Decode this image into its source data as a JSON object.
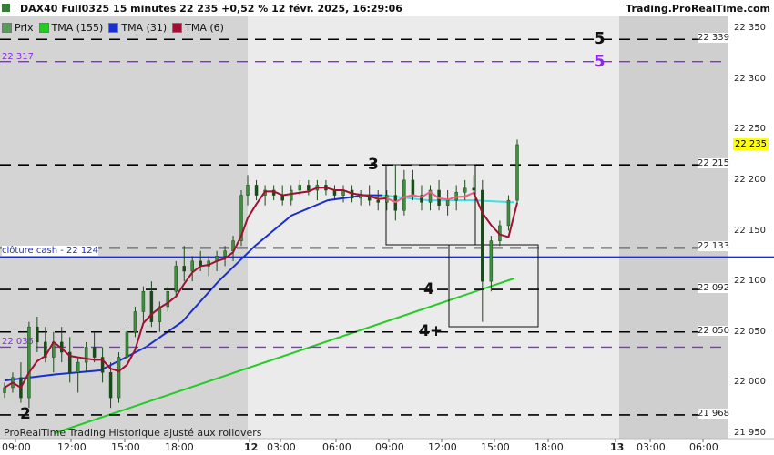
{
  "header": {
    "title": "DAX40 Full0325 15 minutes 22 235 +0,52 % 12 févr. 2025, 16:29:06",
    "brand": "Trading.ProRealTime.com",
    "icon": "price-icon"
  },
  "legend": [
    {
      "label": "Prix",
      "color": "#5a9a5a"
    },
    {
      "label": "TMA (155)",
      "color": "#22cc22"
    },
    {
      "label": "TMA (31)",
      "color": "#1a2fd0"
    },
    {
      "label": "TMA (6)",
      "color": "#a01030"
    }
  ],
  "footer_note": "ProRealTime Trading Historique ajusté aux rollovers",
  "colors": {
    "up": "#3a7a2a",
    "down": "#1a4a1a",
    "tma155": "#22cc22",
    "tma31": "#1a2fd0",
    "tma6": "#a01030",
    "tma6_alt": "#f06080",
    "tma31_alt": "#40e0e0",
    "level_line": "#000000",
    "purple": "#8a2be2",
    "cash_line": "#1a2fd0",
    "last_price_bg": "#ffff00"
  },
  "chart_data": {
    "type": "candlestick",
    "ylim": [
      21950,
      22350
    ],
    "y_ticks": [
      "22 350",
      "22 300",
      "22 250",
      "22 200",
      "22 150",
      "22 100",
      "22 050",
      "22 000",
      "21 950"
    ],
    "x_ticks": [
      {
        "label": "09:00",
        "bold": false
      },
      {
        "label": "12:00",
        "bold": false
      },
      {
        "label": "15:00",
        "bold": false
      },
      {
        "label": "18:00",
        "bold": false
      },
      {
        "label": "12",
        "bold": true
      },
      {
        "label": "03:00",
        "bold": false
      },
      {
        "label": "06:00",
        "bold": false
      },
      {
        "label": "09:00",
        "bold": false
      },
      {
        "label": "12:00",
        "bold": false
      },
      {
        "label": "15:00",
        "bold": false
      },
      {
        "label": "18:00",
        "bold": false
      },
      {
        "label": "13",
        "bold": true
      },
      {
        "label": "03:00",
        "bold": false
      },
      {
        "label": "06:00",
        "bold": false
      }
    ],
    "levels": [
      {
        "value": 22339,
        "label": "22 339",
        "style": "dashed",
        "color": "#000000",
        "marker": "5"
      },
      {
        "value": 22317,
        "label": "22 317",
        "style": "dashed",
        "color": "#8a2be2",
        "marker": "5"
      },
      {
        "value": 22215,
        "label": "22 215",
        "style": "dashed",
        "color": "#000000",
        "marker": "3"
      },
      {
        "value": 22133,
        "label": "22 133",
        "style": "dashed",
        "color": "#000000",
        "marker": ""
      },
      {
        "value": 22092,
        "label": "22 092",
        "style": "dashed",
        "color": "#000000",
        "marker": "4"
      },
      {
        "value": 22050,
        "label": "22 050",
        "style": "dashed",
        "color": "#000000",
        "marker": "4+"
      },
      {
        "value": 22035,
        "label": "22 035",
        "style": "dashed",
        "color": "#8a2be2",
        "marker": ""
      },
      {
        "value": 21968,
        "label": "21 968",
        "style": "dashed",
        "color": "#000000",
        "marker": "2"
      }
    ],
    "cash_close": {
      "value": 22124,
      "label": "clôture cash -  22 124"
    },
    "last_price": {
      "value": 22235,
      "label": "22 235"
    },
    "candles_approx": [
      [
        21990,
        22000,
        21985,
        21995
      ],
      [
        21995,
        22010,
        21990,
        22005
      ],
      [
        22005,
        22020,
        21980,
        21985
      ],
      [
        21985,
        22060,
        21975,
        22055
      ],
      [
        22055,
        22065,
        22030,
        22040
      ],
      [
        22040,
        22055,
        22020,
        22025
      ],
      [
        22025,
        22050,
        22010,
        22040
      ],
      [
        22040,
        22055,
        22020,
        22030
      ],
      [
        22030,
        22045,
        22000,
        22010
      ],
      [
        22010,
        22025,
        21990,
        22020
      ],
      [
        22020,
        22040,
        22010,
        22035
      ],
      [
        22035,
        22050,
        22020,
        22025
      ],
      [
        22025,
        22035,
        22000,
        22010
      ],
      [
        22010,
        22020,
        21975,
        21985
      ],
      [
        21985,
        22030,
        21980,
        22025
      ],
      [
        22025,
        22055,
        22020,
        22050
      ],
      [
        22050,
        22075,
        22045,
        22070
      ],
      [
        22070,
        22095,
        22060,
        22090
      ],
      [
        22090,
        22100,
        22055,
        22060
      ],
      [
        22060,
        22080,
        22050,
        22075
      ],
      [
        22075,
        22095,
        22070,
        22090
      ],
      [
        22090,
        22120,
        22085,
        22115
      ],
      [
        22115,
        22135,
        22100,
        22110
      ],
      [
        22110,
        22125,
        22100,
        22120
      ],
      [
        22120,
        22130,
        22110,
        22115
      ],
      [
        22115,
        22125,
        22105,
        22120
      ],
      [
        22120,
        22130,
        22110,
        22125
      ],
      [
        22125,
        22135,
        22115,
        22130
      ],
      [
        22130,
        22145,
        22120,
        22140
      ],
      [
        22140,
        22190,
        22135,
        22185
      ],
      [
        22185,
        22205,
        22175,
        22195
      ],
      [
        22195,
        22200,
        22180,
        22185
      ],
      [
        22185,
        22195,
        22175,
        22190
      ],
      [
        22190,
        22195,
        22180,
        22185
      ],
      [
        22185,
        22195,
        22175,
        22180
      ],
      [
        22180,
        22195,
        22175,
        22190
      ],
      [
        22190,
        22200,
        22185,
        22195
      ],
      [
        22195,
        22200,
        22185,
        22190
      ],
      [
        22190,
        22200,
        22180,
        22195
      ],
      [
        22195,
        22200,
        22185,
        22190
      ],
      [
        22190,
        22195,
        22180,
        22185
      ],
      [
        22185,
        22195,
        22178,
        22190
      ],
      [
        22190,
        22195,
        22178,
        22182
      ],
      [
        22182,
        22190,
        22175,
        22185
      ],
      [
        22185,
        22195,
        22175,
        22180
      ],
      [
        22180,
        22190,
        22170,
        22178
      ],
      [
        22178,
        22190,
        22170,
        22185
      ],
      [
        22185,
        22215,
        22160,
        22170
      ],
      [
        22170,
        22210,
        22165,
        22200
      ],
      [
        22200,
        22210,
        22180,
        22185
      ],
      [
        22185,
        22195,
        22170,
        22178
      ],
      [
        22178,
        22195,
        22170,
        22190
      ],
      [
        22190,
        22200,
        22170,
        22175
      ],
      [
        22175,
        22190,
        22165,
        22180
      ],
      [
        22180,
        22195,
        22170,
        22188
      ],
      [
        22188,
        22200,
        22180,
        22192
      ],
      [
        22192,
        22205,
        22185,
        22190
      ],
      [
        22190,
        22200,
        22060,
        22100
      ],
      [
        22100,
        22145,
        22090,
        22140
      ],
      [
        22140,
        22160,
        22135,
        22155
      ],
      [
        22155,
        22185,
        22150,
        22180
      ],
      [
        22180,
        22240,
        22175,
        22235
      ]
    ]
  },
  "annotations": {
    "box1_label": "3",
    "box2_label": "4"
  }
}
